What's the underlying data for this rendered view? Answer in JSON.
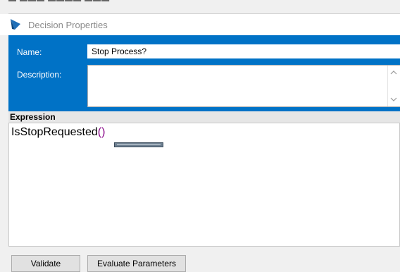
{
  "window": {
    "title": "Decision Properties",
    "icon": "blue-decision-diamond-icon"
  },
  "properties": {
    "name_label": "Name:",
    "name_value": "Stop Process?",
    "description_label": "Description:",
    "description_value": ""
  },
  "expression": {
    "header": "Expression",
    "function_name": "IsStopRequested",
    "parens": "()"
  },
  "buttons": {
    "validate": "Validate",
    "parameters": "Evaluate Parameters"
  },
  "colors": {
    "accent_blue": "#0072c6",
    "paren_purple": "#8b0a8b",
    "title_gray": "#8a8a8a"
  }
}
